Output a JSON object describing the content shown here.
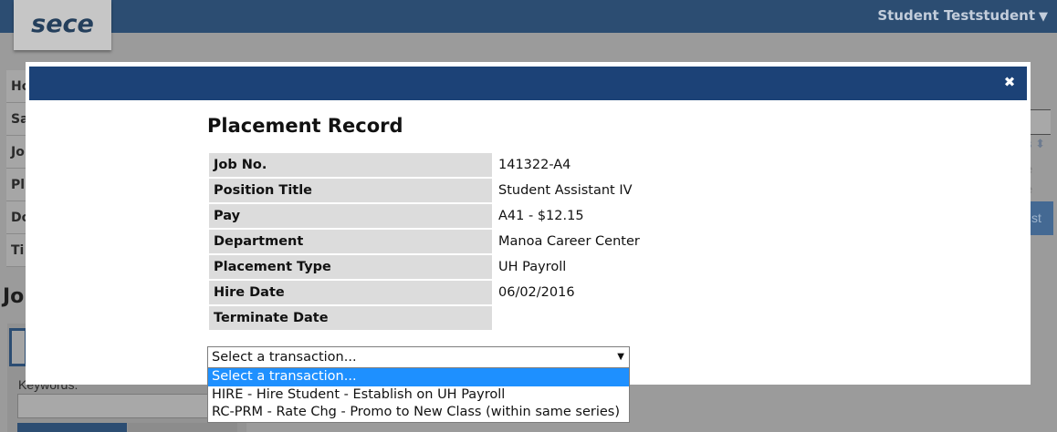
{
  "header": {
    "logo": "sece",
    "user_name": "Student Teststudent",
    "user_caret": "▼"
  },
  "background": {
    "sidebar": [
      "Ho",
      "Sa",
      "Jo",
      "Pl",
      "Do",
      "Ti"
    ],
    "heading": "Jo",
    "keywords_label": "Keywords:",
    "right_select_glyph": "s ⬍",
    "right_text1": "e",
    "right_text2": "e",
    "right_button": "st"
  },
  "modal": {
    "close_icon": "✖",
    "title": "Placement Record",
    "rows": [
      {
        "label": "Job No.",
        "value": "141322-A4"
      },
      {
        "label": "Position Title",
        "value": "Student Assistant IV"
      },
      {
        "label": "Pay",
        "value": "A41 - $12.15"
      },
      {
        "label": "Department",
        "value": "Manoa Career Center"
      },
      {
        "label": "Placement Type",
        "value": "UH Payroll"
      },
      {
        "label": "Hire Date",
        "value": "06/02/2016"
      },
      {
        "label": "Terminate Date",
        "value": ""
      }
    ],
    "transaction_select": {
      "value": "Select a transaction...",
      "arrow": "▼",
      "options": [
        "Select a transaction...",
        "HIRE - Hire Student - Establish on UH Payroll",
        "RC-PRM - Rate Chg - Promo to New Class (within same series)"
      ],
      "highlighted_index": 0
    }
  }
}
